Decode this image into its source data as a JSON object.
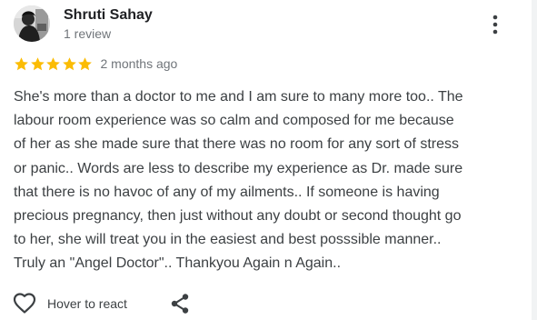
{
  "reviewer": {
    "name": "Shruti Sahay",
    "review_count": "1 review",
    "avatar_icon": "profile-photo"
  },
  "rating": {
    "stars": 5,
    "max_stars": 5,
    "star_color": "#fbbc04",
    "date": "2 months ago"
  },
  "review": {
    "text": "She's more than a doctor to me and I am sure to many more too.. The\nlabour room experience was so calm and composed for me because\nof her as she made sure that there was no room for any sort of stress\nor panic.. Words are less to describe my experience as Dr. made sure\nthat there is no havoc of any of my ailments.. If someone is having\nprecious pregnancy, then just without any doubt or second thought go\nto her, she will treat you in the easiest and best posssible manner..\nTruly an \"Angel Doctor\".. Thankyou Again n Again.."
  },
  "actions": {
    "react_label": "Hover to react",
    "react_icon": "heart-outline-icon",
    "share_icon": "share-icon",
    "more_icon": "more-vertical-icon"
  },
  "colors": {
    "name_text": "#202124",
    "body_text": "#3c4043",
    "secondary_text": "#70757a"
  }
}
